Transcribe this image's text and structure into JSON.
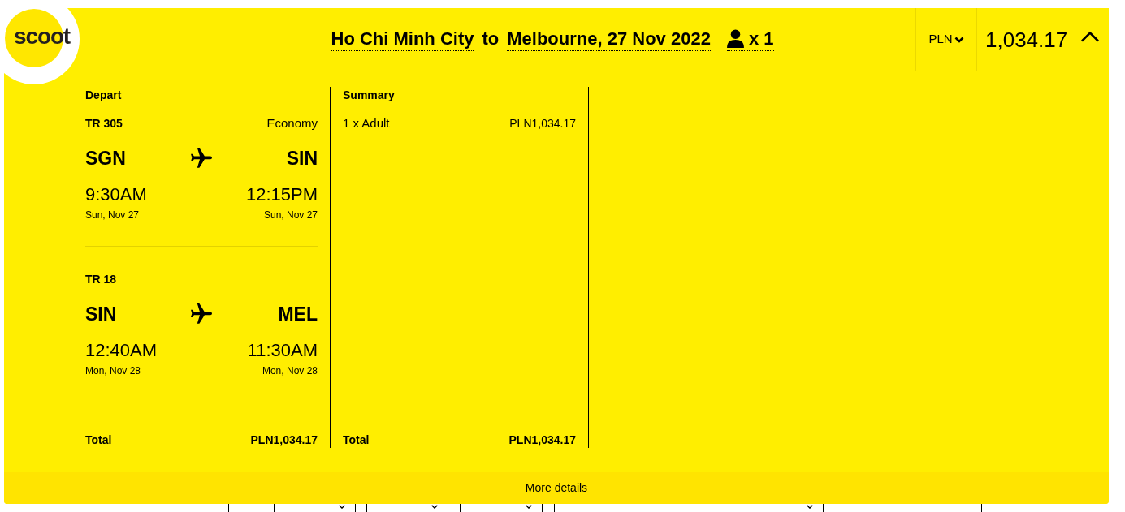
{
  "logo": {
    "text": "scoot"
  },
  "header": {
    "origin": "Ho Chi Minh City",
    "connector": "to",
    "destination": "Melbourne, 27 Nov 2022",
    "passengers": "x 1",
    "currency": "PLN",
    "price": "1,034.17",
    "expanded": true
  },
  "depart": {
    "title": "Depart",
    "segments": [
      {
        "flight": "TR 305",
        "cabin": "Economy",
        "from": {
          "code": "SGN",
          "time": "9:30AM",
          "date": "Sun, Nov 27"
        },
        "to": {
          "code": "SIN",
          "time": "12:15PM",
          "date": "Sun, Nov 27"
        }
      },
      {
        "flight": "TR 18",
        "from": {
          "code": "SIN",
          "time": "12:40AM",
          "date": "Mon, Nov 28"
        },
        "to": {
          "code": "MEL",
          "time": "11:30AM",
          "date": "Mon, Nov 28"
        }
      }
    ],
    "total_label": "Total",
    "total": "PLN1,034.17"
  },
  "summary": {
    "title": "Summary",
    "lines": [
      {
        "label": "1 x Adult",
        "amount": "PLN1,034.17"
      }
    ],
    "total_label": "Total",
    "total": "PLN1,034.17"
  },
  "more_details": "More details",
  "form_behind": {
    "fields": [
      {
        "kind": "input"
      },
      {
        "kind": "dropdown"
      },
      {
        "kind": "dropdown"
      },
      {
        "kind": "dropdown"
      },
      {
        "kind": "dropdown"
      },
      {
        "kind": "input"
      }
    ]
  }
}
